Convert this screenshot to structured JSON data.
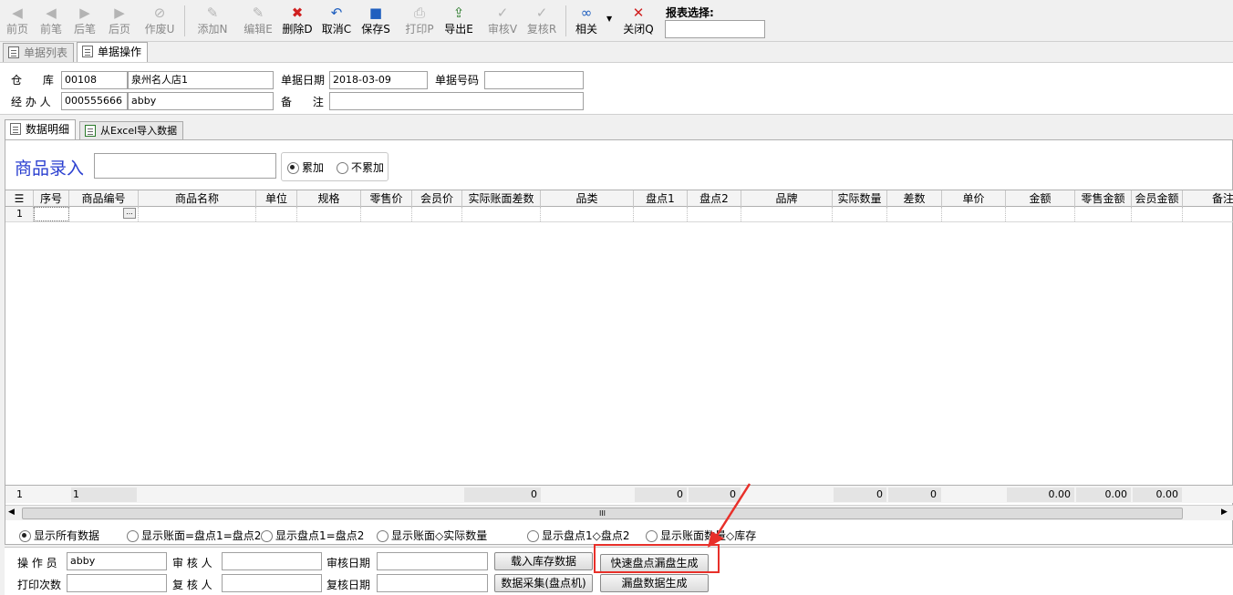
{
  "toolbar": {
    "buttons": [
      {
        "id": "first",
        "label": "前页",
        "icon": "◀"
      },
      {
        "id": "prev",
        "label": "前笔",
        "icon": "◀"
      },
      {
        "id": "next",
        "label": "后笔",
        "icon": "▶"
      },
      {
        "id": "last",
        "label": "后页",
        "icon": "▶"
      },
      {
        "id": "void",
        "label": "作废U",
        "icon": "⊘"
      },
      {
        "id": "add",
        "label": "添加N",
        "icon": "✎"
      },
      {
        "id": "edit",
        "label": "编辑E",
        "icon": "✎"
      },
      {
        "id": "delete",
        "label": "删除D",
        "icon": "✖"
      },
      {
        "id": "cancel",
        "label": "取消C",
        "icon": "↶"
      },
      {
        "id": "save",
        "label": "保存S",
        "icon": "■"
      },
      {
        "id": "print",
        "label": "打印P",
        "icon": "⎙"
      },
      {
        "id": "export",
        "label": "导出E",
        "icon": "⇪"
      },
      {
        "id": "audit",
        "label": "审核V",
        "icon": "✓"
      },
      {
        "id": "reaudit",
        "label": "复核R",
        "icon": "✓"
      },
      {
        "id": "related",
        "label": "相关",
        "icon": "∞"
      },
      {
        "id": "close",
        "label": "关闭Q",
        "icon": "✕"
      }
    ],
    "report_label": "报表选择:",
    "report_value": ""
  },
  "tabs": {
    "list": "单据列表",
    "operation": "单据操作"
  },
  "header": {
    "warehouse_label": "仓      库",
    "warehouse_code": "00108",
    "warehouse_name": "泉州名人店1",
    "date_label": "单据日期",
    "date_value": "2018-03-09",
    "number_label": "单据号码",
    "number_value": "",
    "handler_label": "经 办 人",
    "handler_code": "000555666",
    "handler_name": "abby",
    "remark_label": "备      注",
    "remark_value": ""
  },
  "subtabs": {
    "detail": "数据明细",
    "excel": "从Excel导入数据"
  },
  "entry": {
    "label": "商品录入",
    "value": "",
    "mode_add": "累加",
    "mode_noadd": "不累加"
  },
  "grid": {
    "columns": [
      "序号",
      "商品编号",
      "商品名称",
      "单位",
      "规格",
      "零售价",
      "会员价",
      "实际账面差数",
      "品类",
      "盘点1",
      "盘点2",
      "品牌",
      "实际数量",
      "差数",
      "单价",
      "金额",
      "零售金额",
      "会员金额",
      "备注"
    ],
    "rows": [
      {
        "index": "1"
      }
    ],
    "footer": {
      "row_count": "1",
      "code_count": "1",
      "diff_total": "0",
      "count1_total": "0",
      "count2_total": "0",
      "actual_total": "0",
      "diff_count_total": "0",
      "amount_total": "0.00",
      "retail_total": "0.00",
      "member_total": "0.00"
    },
    "scroll_glyph": "III"
  },
  "filters": [
    {
      "label": "显示所有数据",
      "checked": true
    },
    {
      "label": "显示账面=盘点1=盘点2",
      "checked": false
    },
    {
      "label": "显示盘点1=盘点2",
      "checked": false
    },
    {
      "label": "显示账面◇实际数量",
      "checked": false
    },
    {
      "label": "显示盘点1◇盘点2",
      "checked": false
    },
    {
      "label": "显示账面数量◇库存",
      "checked": false
    }
  ],
  "footer_form": {
    "operator_label": "操 作 员",
    "operator_value": "abby",
    "auditor_label": "审 核 人",
    "auditor_value": "",
    "audit_date_label": "审核日期",
    "audit_date_value": "",
    "print_count_label": "打印次数",
    "print_count_value": "",
    "reviewer_label": "复 核 人",
    "reviewer_value": "",
    "review_date_label": "复核日期",
    "review_date_value": "",
    "btn_load_stock": "载入库存数据",
    "btn_quick_generate": "快速盘点漏盘生成",
    "btn_collect": "数据采集(盘点机)",
    "btn_missing_generate": "漏盘数据生成"
  },
  "colors": {
    "highlight": "#e8302a",
    "entry_label": "#2a3fd0"
  }
}
